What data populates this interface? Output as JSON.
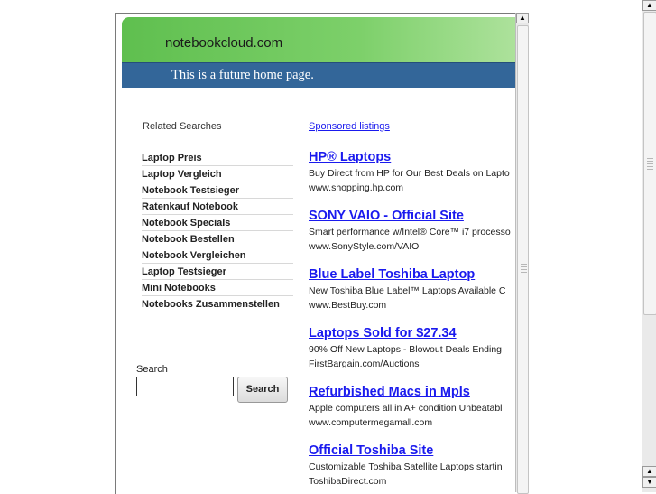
{
  "header": {
    "domain": "notebookcloud.com",
    "tagline": "This is a future home page."
  },
  "related": {
    "title": "Related Searches",
    "items": [
      "Laptop Preis",
      "Laptop Vergleich",
      "Notebook Testsieger",
      "Ratenkauf Notebook",
      "Notebook Specials",
      "Notebook Bestellen",
      "Notebook Vergleichen",
      "Laptop Testsieger",
      "Mini Notebooks",
      "Notebooks Zusammenstellen"
    ]
  },
  "search": {
    "label": "Search",
    "button": "Search",
    "value": ""
  },
  "sponsored": {
    "heading": "Sponsored listings",
    "ads": [
      {
        "title": "HP® Laptops",
        "desc": "Buy Direct from HP for Our Best Deals on Lapto",
        "url": "www.shopping.hp.com"
      },
      {
        "title": "SONY VAIO - Official Site",
        "desc": "Smart performance w/Intel® Core™ i7 processo",
        "url": "www.SonyStyle.com/VAIO"
      },
      {
        "title": "Blue Label Toshiba Laptop",
        "desc": "New Toshiba Blue Label™ Laptops Available C",
        "url": "www.BestBuy.com"
      },
      {
        "title": "Laptops Sold for $27.34",
        "desc": "90% Off New Laptops - Blowout Deals Ending",
        "url": "FirstBargain.com/Auctions"
      },
      {
        "title": "Refurbished Macs in Mpls",
        "desc": "Apple computers all in A+ condition Unbeatabl",
        "url": "www.computermegamall.com"
      },
      {
        "title": "Official Toshiba Site",
        "desc": "Customizable Toshiba Satellite Laptops startin",
        "url": "ToshibaDirect.com"
      }
    ]
  },
  "scrollbar": {
    "up_glyph": "▲",
    "down_glyph": "▼"
  }
}
